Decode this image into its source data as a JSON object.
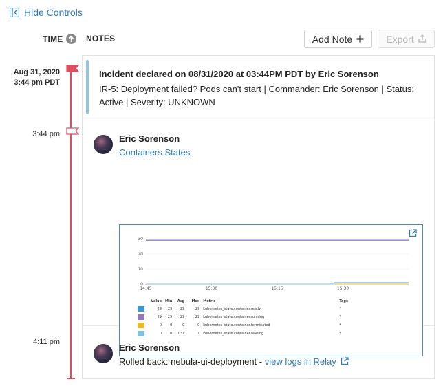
{
  "controls": {
    "hide_label": "Hide Controls"
  },
  "columns": {
    "time": "TIME",
    "notes": "NOTES"
  },
  "toolbar": {
    "add_note_label": "Add Note",
    "export_label": "Export"
  },
  "timeline": {
    "incident_date": "Aug 31, 2020",
    "incident_time": "3:44 pm PDT",
    "note1_time": "3:44 pm",
    "note2_time": "4:11 pm"
  },
  "incident": {
    "title": "Incident declared on 08/31/2020 at 03:44PM PDT by Eric Sorenson",
    "detail": "IR-5: Deployment failed? Pods can't start | Commander: Eric Sorenson | Status: Active | Severity: UNKNOWN"
  },
  "notes": [
    {
      "author": "Eric Sorenson",
      "link": "Containers States"
    },
    {
      "author": "Eric Sorenson",
      "text": "Rolled back: nebula-ui-deployment - ",
      "link": "view logs in Relay"
    }
  ],
  "chart_data": {
    "type": "line",
    "title": "",
    "xlabel": "",
    "ylabel": "",
    "x_ticks": [
      "14:45",
      "15:00",
      "15:15",
      "15:30"
    ],
    "y_ticks": [
      0,
      10,
      20,
      30
    ],
    "ylim": [
      0,
      30
    ],
    "xlim_minutes": [
      0,
      60
    ],
    "series": [
      {
        "name": "kubernetes_state.container.ready",
        "color": "#3b9ad6",
        "value": 29,
        "min": 29,
        "avg": 29,
        "max": 29,
        "tags": "*",
        "points": [
          [
            0,
            29
          ],
          [
            60,
            29
          ]
        ]
      },
      {
        "name": "kubernetes_state.container.running",
        "color": "#9179c0",
        "value": 29,
        "min": 29,
        "avg": 29,
        "max": 29,
        "tags": "*",
        "points": [
          [
            0,
            29
          ],
          [
            60,
            29
          ]
        ]
      },
      {
        "name": "kubernetes_state.container.terminated",
        "color": "#e9b929",
        "value": 0,
        "min": 0,
        "avg": 0,
        "max": 0,
        "tags": "*",
        "points": [
          [
            0,
            0
          ],
          [
            60,
            0
          ]
        ]
      },
      {
        "name": "kubernetes_state.container.waiting",
        "color": "#7fc1e0",
        "value": 0,
        "min": 0,
        "avg": 0.31,
        "max": 1,
        "tags": "*",
        "points": [
          [
            0,
            0
          ],
          [
            43,
            0
          ],
          [
            43,
            1
          ],
          [
            60,
            1
          ]
        ]
      }
    ],
    "legend_headers": {
      "value": "Value",
      "min": "Min",
      "avg": "Avg",
      "max": "Max",
      "metric": "Metric",
      "tags": "Tags"
    }
  },
  "colors": {
    "accent": "#2f7bbf",
    "timeline": "#e04e5e",
    "incident_bar": "#93c4e2"
  }
}
